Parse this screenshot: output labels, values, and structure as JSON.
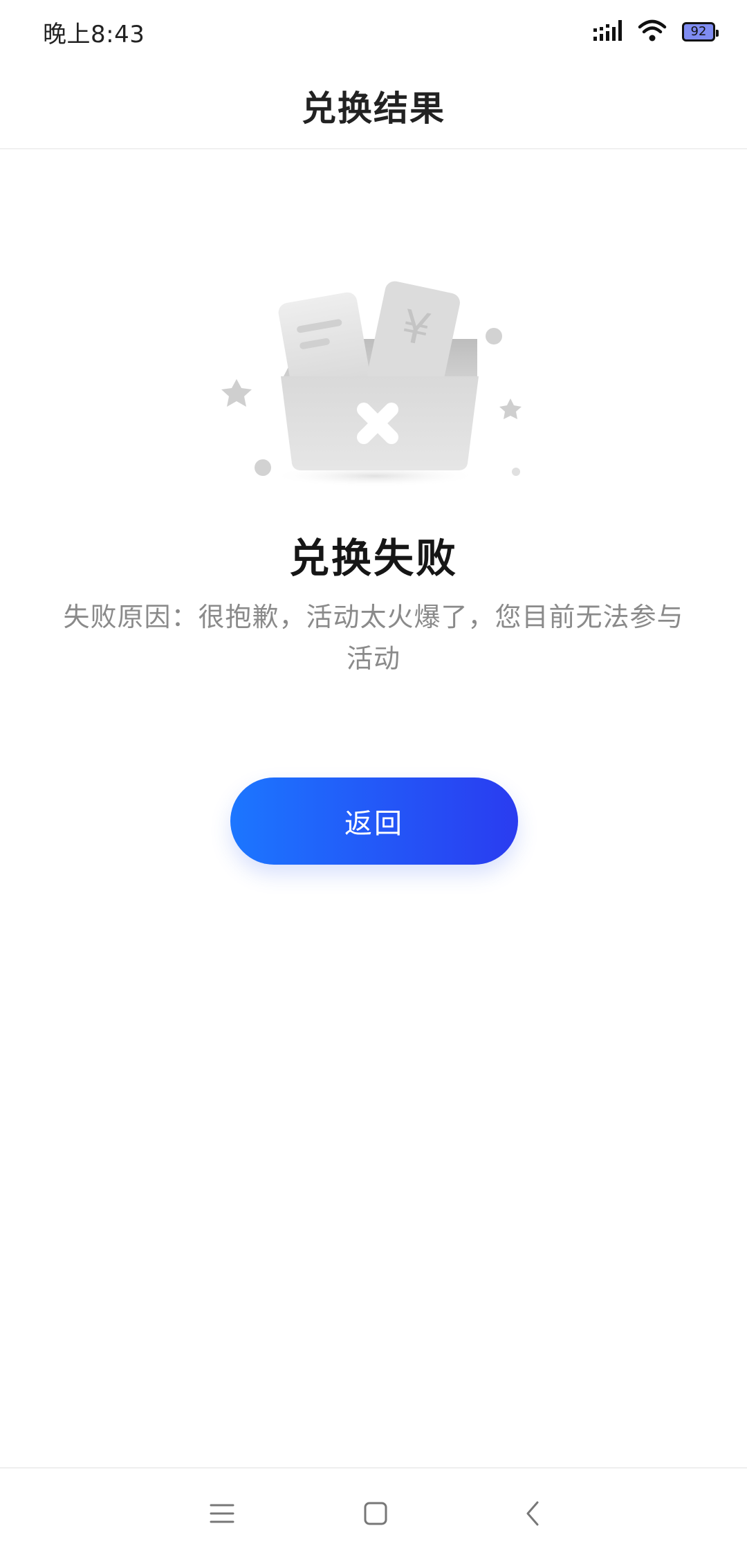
{
  "status_bar": {
    "time": "晚上8:43",
    "battery_level": "92",
    "icons": [
      "signal-icon",
      "wifi-icon",
      "battery-icon"
    ]
  },
  "header": {
    "title": "兑换结果"
  },
  "illustration": {
    "icon": "failed-exchange-box-icon",
    "currency_symbol": "¥"
  },
  "result": {
    "title": "兑换失败",
    "reason": "失败原因：很抱歉，活动太火爆了，您目前无法参与活动"
  },
  "actions": {
    "back_label": "返回",
    "accent_start": "#1c76ff",
    "accent_end": "#2a3cf0"
  },
  "nav_bar": {
    "items": [
      "menu-icon",
      "home-icon",
      "back-icon"
    ]
  }
}
